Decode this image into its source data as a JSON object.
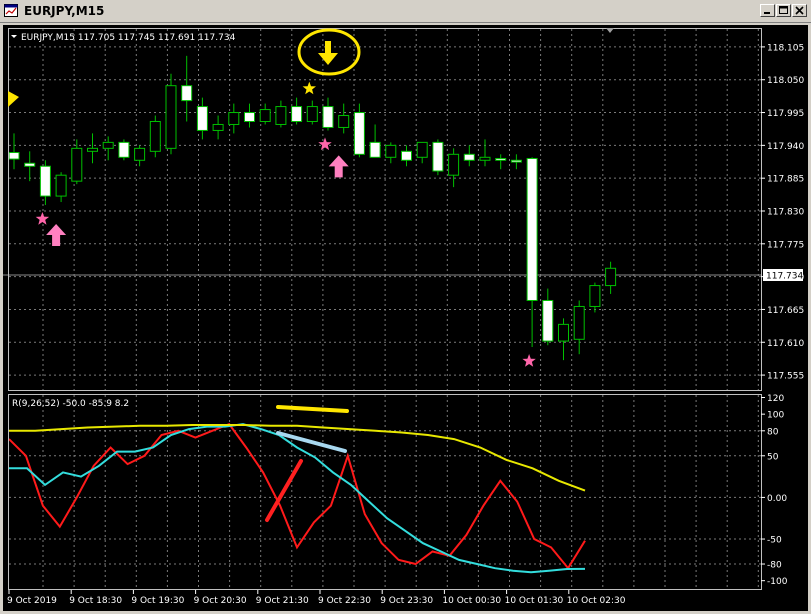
{
  "window": {
    "title": "EURJPY,M15"
  },
  "main_header": "EURJPY,M15 117.705 117.745 117.691 117.734",
  "indicator_header": "R(9,26,52) -50.0 -85.9 8.2",
  "current_price_label": "117.734",
  "colors": {
    "background": "#000000",
    "grid": "#7a7a7a",
    "bull_candle": "#000000",
    "bear_candle": "#ffffff",
    "wick": "#00c000",
    "line_fast": "#ff1a1a",
    "line_mid": "#33dddd",
    "line_slow": "#e8e800",
    "buy_arrow": "#ff80c0",
    "sell_arrow": "#ffff00",
    "star": "#ff66aa",
    "annotation_yellow": "#ffe600",
    "annotation_blue": "#a8d8f0",
    "annotation_red": "#ff2020"
  },
  "chart_data": [
    {
      "type": "candlestick",
      "symbol": "EURJPY",
      "timeframe": "M15",
      "ylim": [
        117.53,
        118.135
      ],
      "y_ticks": [
        "118.105",
        "118.050",
        "117.995",
        "117.940",
        "117.885",
        "117.830",
        "117.775",
        "117.720",
        "117.665",
        "117.610",
        "117.555"
      ],
      "x_ticks": [
        "9 Oct 2019",
        "9 Oct 18:30",
        "9 Oct 19:30",
        "9 Oct 20:30",
        "9 Oct 21:30",
        "9 Oct 22:30",
        "9 Oct 23:30",
        "10 Oct 00:30",
        "10 Oct 01:30",
        "10 Oct 02:30"
      ],
      "candles": [
        {
          "o": 117.928,
          "h": 117.96,
          "l": 117.9,
          "c": 117.917
        },
        {
          "o": 117.91,
          "h": 117.93,
          "l": 117.88,
          "c": 117.905
        },
        {
          "o": 117.905,
          "h": 117.915,
          "l": 117.84,
          "c": 117.855
        },
        {
          "o": 117.855,
          "h": 117.895,
          "l": 117.845,
          "c": 117.89
        },
        {
          "o": 117.88,
          "h": 117.95,
          "l": 117.875,
          "c": 117.935
        },
        {
          "o": 117.93,
          "h": 117.96,
          "l": 117.91,
          "c": 117.935
        },
        {
          "o": 117.935,
          "h": 117.955,
          "l": 117.915,
          "c": 117.945
        },
        {
          "o": 117.945,
          "h": 117.95,
          "l": 117.915,
          "c": 117.92
        },
        {
          "o": 117.915,
          "h": 117.94,
          "l": 117.905,
          "c": 117.935
        },
        {
          "o": 117.93,
          "h": 117.99,
          "l": 117.92,
          "c": 117.98
        },
        {
          "o": 117.935,
          "h": 118.06,
          "l": 117.925,
          "c": 118.04
        },
        {
          "o": 118.04,
          "h": 118.09,
          "l": 117.98,
          "c": 118.015
        },
        {
          "o": 118.005,
          "h": 118.02,
          "l": 117.95,
          "c": 117.965
        },
        {
          "o": 117.965,
          "h": 117.99,
          "l": 117.95,
          "c": 117.975
        },
        {
          "o": 117.975,
          "h": 118.01,
          "l": 117.96,
          "c": 117.995
        },
        {
          "o": 117.995,
          "h": 118.01,
          "l": 117.97,
          "c": 117.98
        },
        {
          "o": 117.98,
          "h": 118.01,
          "l": 117.975,
          "c": 118.0
        },
        {
          "o": 117.975,
          "h": 118.015,
          "l": 117.97,
          "c": 118.005
        },
        {
          "o": 118.005,
          "h": 118.02,
          "l": 117.975,
          "c": 117.98
        },
        {
          "o": 117.98,
          "h": 118.015,
          "l": 117.975,
          "c": 118.005
        },
        {
          "o": 118.005,
          "h": 118.02,
          "l": 117.965,
          "c": 117.97
        },
        {
          "o": 117.97,
          "h": 118.01,
          "l": 117.96,
          "c": 117.99
        },
        {
          "o": 117.995,
          "h": 118.01,
          "l": 117.92,
          "c": 117.925
        },
        {
          "o": 117.945,
          "h": 117.975,
          "l": 117.925,
          "c": 117.92
        },
        {
          "o": 117.92,
          "h": 117.945,
          "l": 117.91,
          "c": 117.94
        },
        {
          "o": 117.93,
          "h": 117.94,
          "l": 117.905,
          "c": 117.915
        },
        {
          "o": 117.92,
          "h": 117.945,
          "l": 117.91,
          "c": 117.945
        },
        {
          "o": 117.945,
          "h": 117.95,
          "l": 117.89,
          "c": 117.897
        },
        {
          "o": 117.89,
          "h": 117.935,
          "l": 117.87,
          "c": 117.925
        },
        {
          "o": 117.925,
          "h": 117.94,
          "l": 117.905,
          "c": 117.915
        },
        {
          "o": 117.915,
          "h": 117.95,
          "l": 117.905,
          "c": 117.92
        },
        {
          "o": 117.918,
          "h": 117.925,
          "l": 117.9,
          "c": 117.915
        },
        {
          "o": 117.915,
          "h": 117.925,
          "l": 117.9,
          "c": 117.912
        },
        {
          "o": 117.918,
          "h": 117.92,
          "l": 117.602,
          "c": 117.68
        },
        {
          "o": 117.68,
          "h": 117.7,
          "l": 117.605,
          "c": 117.612
        },
        {
          "o": 117.612,
          "h": 117.65,
          "l": 117.58,
          "c": 117.64
        },
        {
          "o": 117.615,
          "h": 117.68,
          "l": 117.59,
          "c": 117.67
        },
        {
          "o": 117.67,
          "h": 117.71,
          "l": 117.66,
          "c": 117.705
        },
        {
          "o": 117.705,
          "h": 117.745,
          "l": 117.691,
          "c": 117.734
        }
      ],
      "buy_signals": [
        3,
        21
      ],
      "sell_signals": [
        20
      ],
      "stars_below": [
        2,
        20,
        33
      ],
      "stars_above": [
        19
      ]
    },
    {
      "type": "line",
      "indicator": "R(9,26,52)",
      "ylim": [
        -110,
        123
      ],
      "y_ticks": [
        "120",
        "100",
        "80",
        "50",
        "0.00",
        "-50",
        "-80",
        "-100"
      ],
      "levels": [
        80,
        50,
        0,
        -50,
        -80
      ],
      "series": [
        {
          "values": [
            70,
            50,
            -10,
            -35,
            0,
            38,
            60,
            40,
            50,
            75,
            80,
            72,
            80,
            88,
            60,
            30,
            -10,
            -60,
            -30,
            -10,
            50,
            -20,
            -55,
            -75,
            -80,
            -65,
            -70,
            -45,
            -10,
            20,
            -5,
            -50,
            -60,
            -85,
            -52
          ]
        },
        {
          "values": [
            35,
            35,
            15,
            30,
            25,
            38,
            55,
            55,
            60,
            75,
            82,
            85,
            85,
            88,
            82,
            75,
            60,
            48,
            30,
            15,
            -5,
            -25,
            -40,
            -55,
            -65,
            -75,
            -80,
            -85,
            -88,
            -90,
            -88,
            -86,
            -85.9
          ]
        },
        {
          "values": [
            80,
            80,
            82,
            84,
            85,
            86,
            86,
            87,
            87,
            87,
            86,
            86,
            84,
            82,
            80,
            78,
            75,
            70,
            60,
            45,
            35,
            20,
            8.2
          ]
        }
      ]
    }
  ]
}
